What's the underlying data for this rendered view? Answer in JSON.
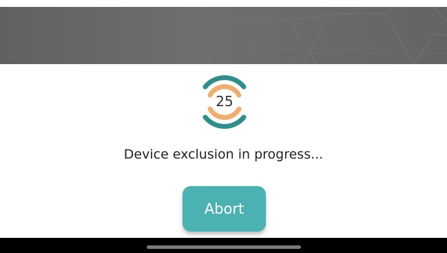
{
  "progress": {
    "countdown": "25",
    "spinner_icon": "circular-progress-spinner",
    "status_text": "Device exclusion in progress..."
  },
  "actions": {
    "abort_label": "Abort"
  },
  "colors": {
    "accent_teal": "#4bb1b3",
    "spinner_dark": "#2f8e8b",
    "spinner_light": "#f0ad6e",
    "banner_gray": "#666869"
  }
}
